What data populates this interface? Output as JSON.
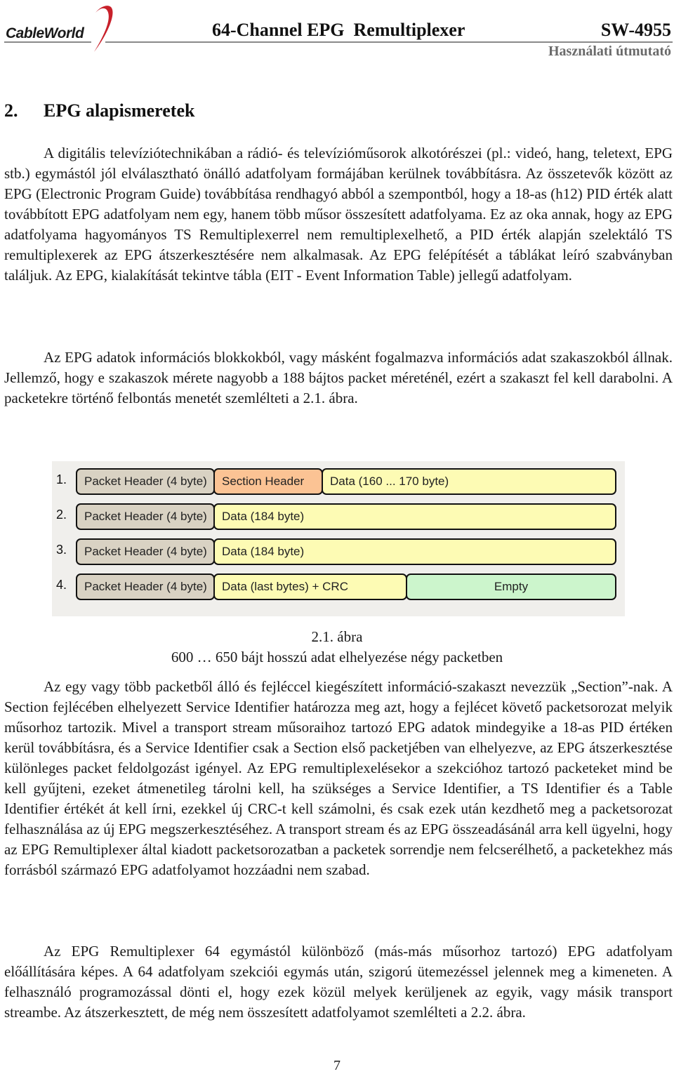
{
  "header": {
    "logo_text": "CableWorld",
    "title": "64-Channel EPG  Remultiplexer",
    "model": "SW-4955",
    "subtitle": "Használati útmutató",
    "accent_color": "#c8202a"
  },
  "section": {
    "number": "2.",
    "title": "EPG alapismeretek"
  },
  "paragraphs": [
    "A digitális televíziótechnikában a rádió- és televízióműsorok alkotórészei (pl.: videó, hang, teletext, EPG stb.) egymástól jól elválasztható önálló adatfolyam formájában kerülnek továbbításra. Az összetevők között az EPG (Electronic Program Guide) továbbítása rendhagyó abból a szempontból, hogy a 18-as (h12) PID érték alatt továbbított EPG adatfolyam nem egy, hanem több műsor összesített adatfolyama. Ez az oka annak, hogy az EPG adatfolyama hagyományos TS Remultiplexerrel nem remultiplexelhető, a PID érték alapján szelektáló TS remultiplexerek az EPG átszerkesztésére nem alkalmasak. Az EPG felépítését a táblákat leíró szabványban találjuk. Az EPG, kialakítását tekintve tábla (EIT - Event Information Table) jellegű adatfolyam.",
    "Az EPG adatok információs blokkokból, vagy másként fogalmazva információs adat szakaszokból állnak. Jellemző, hogy e szakaszok mérete nagyobb a 188 bájtos packet méreténél, ezért a szakaszt fel kell darabolni. A packetekre történő felbontás menetét szemlélteti a 2.1. ábra.",
    "Az egy vagy több packetből álló és fejléccel kiegészített információ-szakaszt nevezzük „Section”-nak. A Section fejlécében elhelyezett Service Identifier határozza meg azt, hogy a fejlécet követő packetsorozat melyik műsorhoz tartozik. Mivel a transport stream műsoraihoz tartozó EPG adatok mindegyike a 18-as PID értéken kerül továbbításra, és a Service Identifier csak a Section első packetjében van elhelyezve, az EPG átszerkesztése különleges packet feldolgozást igényel. Az EPG remultiplexelésekor a szekcióhoz tartozó packeteket mind be kell gyűjteni, ezeket átmenetileg tárolni kell, ha szükséges a Service Identifier, a TS Identifier és a Table Identifier értékét át kell írni, ezekkel új CRC-t kell számolni, és csak ezek után kezdhető meg a packetsorozat felhasználása az új EPG megszerkesztéséhez. A transport stream és az EPG összeadásánál arra kell ügyelni, hogy az EPG Remultiplexer által kiadott packetsorozatban a packetek sorrendje nem felcserélhető, a packetekhez más forrásból származó EPG adatfolyamot hozzáadni nem szabad.",
    "Az EPG Remultiplexer 64 egymástól különböző (más-más műsorhoz tartozó) EPG adatfolyam előállítására képes. A 64 adatfolyam szekciói egymás után, szigorú ütemezéssel jelennek meg a kimeneten. A felhasználó programozással dönti el, hogy ezek közül melyek kerüljenek az egyik, vagy másik transport streambe.  Az átszerkesztett, de még nem összesített adatfolyamot szemlélteti a 2.2. ábra."
  ],
  "figure": {
    "rows": [
      {
        "number": "1.",
        "cells": [
          {
            "label": "Packet Header (4 byte)",
            "kind": "packet-header",
            "color": "#d9d2c3"
          },
          {
            "label": "Section Header",
            "kind": "section-header",
            "color": "#fbc394"
          },
          {
            "label": "Data (160 ... 170 byte)",
            "kind": "data",
            "color": "#fdfbb4"
          }
        ]
      },
      {
        "number": "2.",
        "cells": [
          {
            "label": "Packet Header (4 byte)",
            "kind": "packet-header",
            "color": "#d9d2c3"
          },
          {
            "label": "Data (184 byte)",
            "kind": "data",
            "color": "#fdfbb4"
          }
        ]
      },
      {
        "number": "3.",
        "cells": [
          {
            "label": "Packet Header (4 byte)",
            "kind": "packet-header",
            "color": "#d9d2c3"
          },
          {
            "label": "Data (184 byte)",
            "kind": "data",
            "color": "#fdfbb4"
          }
        ]
      },
      {
        "number": "4.",
        "cells": [
          {
            "label": "Packet Header (4 byte)",
            "kind": "packet-header",
            "color": "#d9d2c3"
          },
          {
            "label": "Data (last bytes) + CRC",
            "kind": "data",
            "color": "#fdfbb4"
          },
          {
            "label": "Empty",
            "kind": "empty",
            "color": "#ccf5cc"
          }
        ]
      }
    ],
    "caption_number": "2.1. ábra",
    "caption_text": "600 … 650 bájt hosszú adat elhelyezése négy packetben"
  },
  "page_number": "7"
}
